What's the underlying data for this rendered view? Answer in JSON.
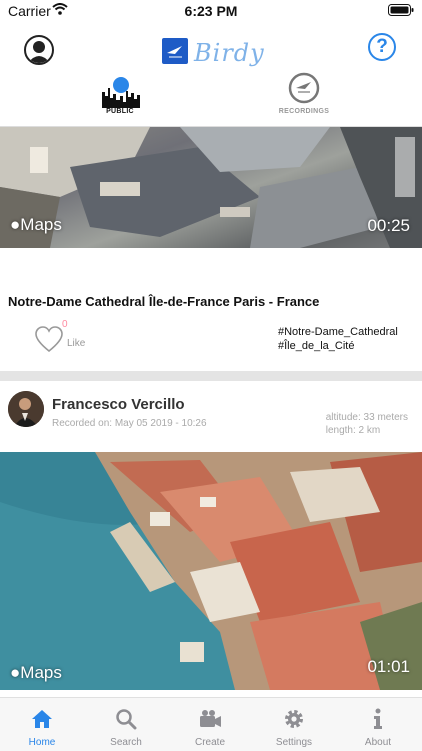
{
  "status_bar": {
    "carrier": "Carrier",
    "time": "6:23 PM"
  },
  "header": {
    "brand_name": "Birdy",
    "help_glyph": "?"
  },
  "modes": [
    {
      "label": "PUBLIC",
      "active": true
    },
    {
      "label": "RECORDINGS",
      "active": false
    }
  ],
  "posts": [
    {
      "maps_label": "Maps",
      "duration": "00:25",
      "title": "Notre-Dame Cathedral Île-de-France Paris - France",
      "like_count": "0",
      "like_label": "Like",
      "tags": [
        "#Notre-Dame_Cathedral",
        "#Île_de_la_Cité"
      ]
    },
    {
      "author": "Francesco Vercillo",
      "recorded_on": "Recorded on: May 05 2019 - 10:26",
      "altitude": "altitude: 33 meters",
      "length": "length: 2 km",
      "maps_label": "Maps",
      "duration": "01:01"
    }
  ],
  "tab_bar": [
    {
      "label": "Home",
      "icon": "home-icon",
      "active": true
    },
    {
      "label": "Search",
      "icon": "search-icon",
      "active": false
    },
    {
      "label": "Create",
      "icon": "video-camera-icon",
      "active": false
    },
    {
      "label": "Settings",
      "icon": "gear-icon",
      "active": false
    },
    {
      "label": "About",
      "icon": "info-icon",
      "active": false
    }
  ],
  "colors": {
    "accent": "#2a86e8",
    "brand": "#1e5bc6",
    "like": "#ff8aa0"
  }
}
